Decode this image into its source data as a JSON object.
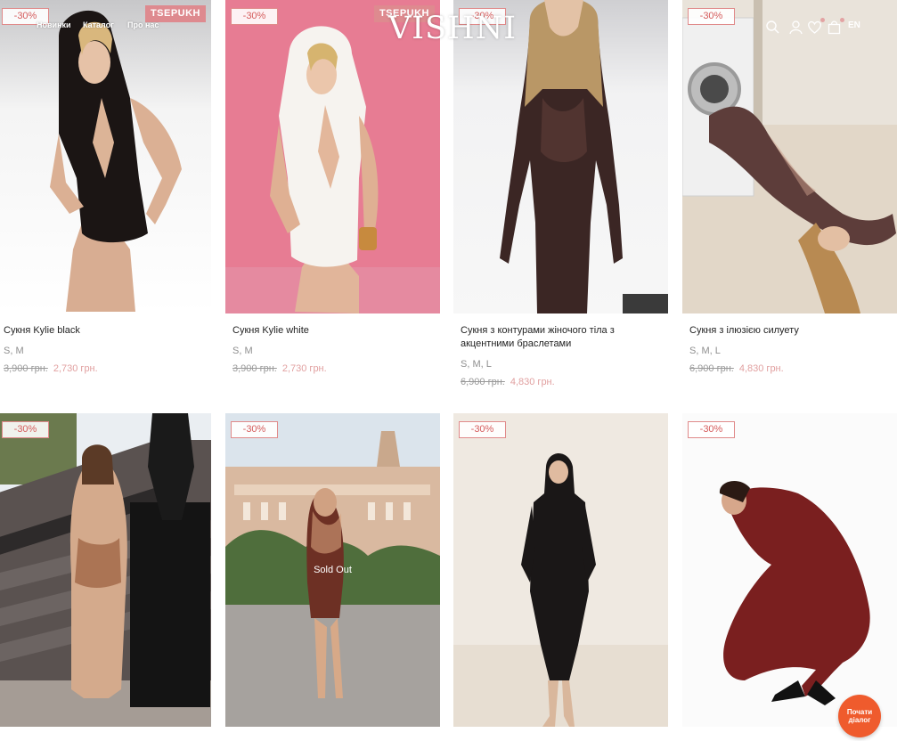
{
  "header": {
    "nav": [
      "Новинки",
      "Каталог",
      "Про нас"
    ],
    "logo": "VISHNI",
    "lang": "EN",
    "icons": [
      "search-icon",
      "user-icon",
      "heart-icon",
      "bag-icon"
    ]
  },
  "products": [
    {
      "name": "Сукня Kylie black",
      "sizes": "S, M",
      "old_price": "3,900 грн.",
      "new_price": "2,730 грн.",
      "badge": "-30%",
      "brand": "TSEPUKH"
    },
    {
      "name": "Сукня Kylie white",
      "sizes": "S, M",
      "old_price": "3,900 грн.",
      "new_price": "2,730 грн.",
      "badge": "-30%",
      "brand": "TSEPUKH"
    },
    {
      "name": "Сукня з контурами жіночого тіла з акцентними браслетами",
      "sizes": "S, M, L",
      "old_price": "6,900 грн.",
      "new_price": "4,830 грн.",
      "badge": "-30%"
    },
    {
      "name": "Сукня з ілюзією силуету",
      "sizes": "S, M, L",
      "old_price": "6,900 грн.",
      "new_price": "4,830 грн.",
      "badge": "-30%"
    },
    {
      "badge": "-30%"
    },
    {
      "badge": "-30%",
      "status": "Sold Out"
    },
    {
      "badge": "-30%"
    },
    {
      "badge": "-30%"
    }
  ],
  "chat": {
    "line1": "Почати",
    "line2": "діалог"
  },
  "colors": {
    "accent": "#de8a8f",
    "sale_text": "#e1a0a0",
    "chat": "#ef5b2d"
  }
}
